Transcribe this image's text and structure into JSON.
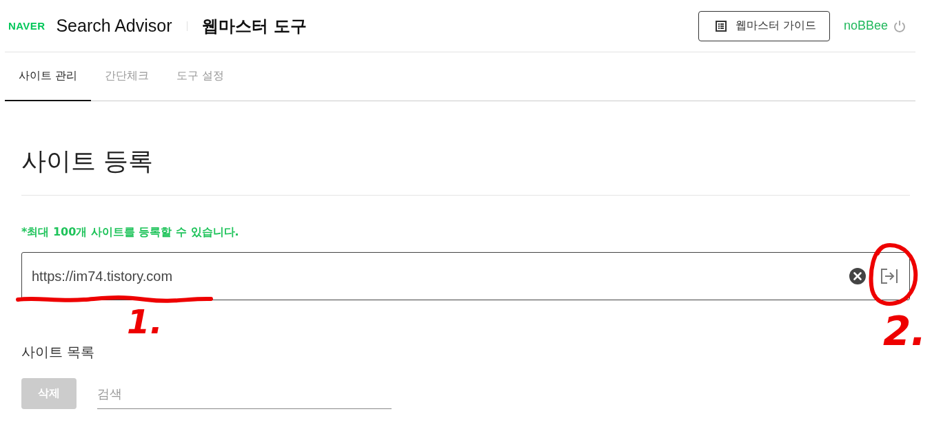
{
  "header": {
    "logo": "NAVER",
    "product": "Search Advisor",
    "title": "웹마스터 도구",
    "guide_button": "웹마스터 가이드",
    "user": "noBBee"
  },
  "tabs": [
    {
      "label": "사이트 관리",
      "selected": true
    },
    {
      "label": "간단체크",
      "selected": false
    },
    {
      "label": "도구 설정",
      "selected": false
    }
  ],
  "page_title": "사이트 등록",
  "notice": "*최대 100개 사이트를 등록할 수 있습니다.",
  "site_input": {
    "value": "https://im74.tistory.com"
  },
  "site_list": {
    "heading": "사이트 목록",
    "delete_button": {
      "label": "삭제",
      "disabled": true
    },
    "search": {
      "placeholder": "검색"
    }
  },
  "annotations": [
    {
      "kind": "underline",
      "label": "1."
    },
    {
      "kind": "circle",
      "label": "2."
    }
  ]
}
